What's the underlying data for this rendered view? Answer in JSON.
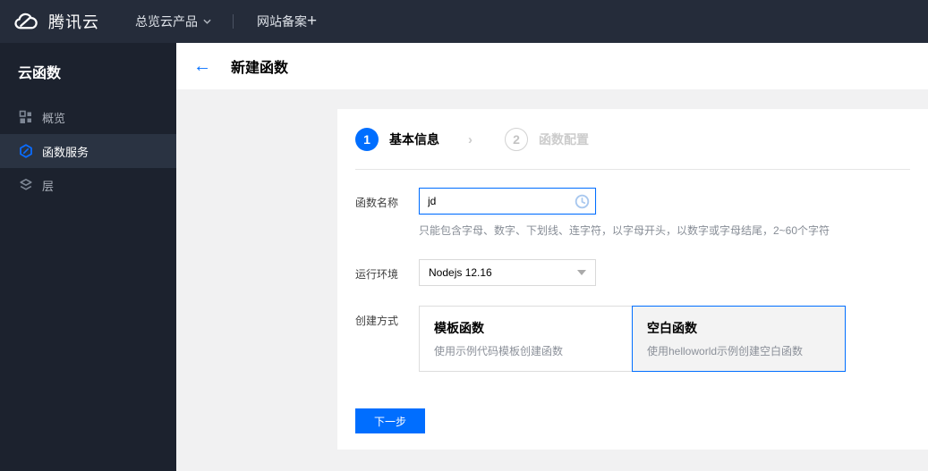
{
  "navbar": {
    "brand": "腾讯云",
    "items": [
      {
        "label": "总览"
      },
      {
        "label": "云产品"
      },
      {
        "label": "网站备案"
      },
      {
        "label": "+"
      }
    ]
  },
  "sidebar": {
    "title": "云函数",
    "items": [
      {
        "label": "概览",
        "icon": "grid-icon",
        "active": false
      },
      {
        "label": "函数服务",
        "icon": "function-service-icon",
        "active": true
      },
      {
        "label": "层",
        "icon": "layers-icon",
        "active": false
      }
    ]
  },
  "header": {
    "title": "新建函数"
  },
  "steps": [
    {
      "number": "1",
      "label": "基本信息",
      "state": "active"
    },
    {
      "number": "2",
      "label": "函数配置",
      "state": "pending"
    }
  ],
  "form": {
    "name": {
      "label": "函数名称",
      "value": "jd",
      "hint": "只能包含字母、数字、下划线、连字符，以字母开头，以数字或字母结尾，2~60个字符"
    },
    "runtime": {
      "label": "运行环境",
      "value": "Nodejs 12.16"
    },
    "method": {
      "label": "创建方式",
      "options": [
        {
          "title": "模板函数",
          "desc": "使用示例代码模板创建函数",
          "selected": false
        },
        {
          "title": "空白函数",
          "desc": "使用helloworld示例创建空白函数",
          "selected": true
        }
      ]
    }
  },
  "actions": {
    "next_label": "下一步"
  },
  "colors": {
    "accent": "#006eff",
    "navbar_bg": "#252c3a",
    "sidebar_bg": "#1c222e",
    "sidebar_active_bg": "#2a3342",
    "content_bg": "#f1f1f2"
  }
}
